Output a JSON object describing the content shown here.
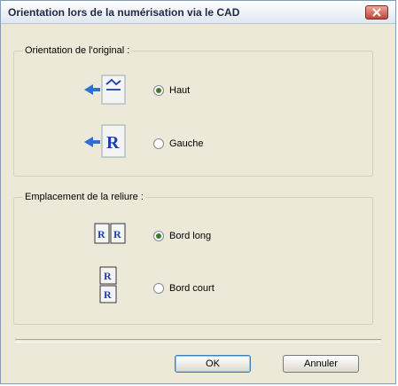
{
  "window": {
    "title": "Orientation lors de la numérisation via le CAD"
  },
  "orientation": {
    "legend": "Orientation de l'original :",
    "options": [
      {
        "label": "Haut",
        "checked": true,
        "icon": "upright-page-arrow-icon"
      },
      {
        "label": "Gauche",
        "checked": false,
        "icon": "rotated-page-R-arrow-icon"
      }
    ]
  },
  "binding": {
    "legend": "Emplacement de la reliure :",
    "options": [
      {
        "label": "Bord long",
        "checked": true,
        "icon": "long-edge-binding-icon"
      },
      {
        "label": "Bord court",
        "checked": false,
        "icon": "short-edge-binding-icon"
      }
    ]
  },
  "buttons": {
    "ok": "OK",
    "cancel": "Annuler"
  },
  "colors": {
    "accent_blue": "#1b3faf",
    "arrow_blue": "#2f6fd8"
  }
}
